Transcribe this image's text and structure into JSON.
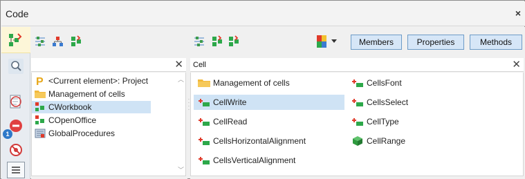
{
  "window": {
    "title": "Code",
    "close_label": "×"
  },
  "left": {
    "filter_value": "",
    "filter_clear": "✕",
    "items": [
      {
        "label": "<Current element>: Project",
        "icon": "project-p-icon"
      },
      {
        "label": "Management of cells",
        "icon": "folder-icon"
      },
      {
        "label": "CWorkbook",
        "icon": "class-icon",
        "selected": true
      },
      {
        "label": "COpenOffice",
        "icon": "class-icon"
      },
      {
        "label": "GlobalProcedures",
        "icon": "global-procedures-icon"
      }
    ]
  },
  "right": {
    "filter_value": "Cell",
    "filter_clear": "✕",
    "buttons": {
      "members": "Members",
      "properties": "Properties",
      "methods": "Methods"
    },
    "col1": [
      {
        "label": "Management of cells",
        "icon": "folder-icon"
      },
      {
        "label": "CellWrite",
        "icon": "method-icon",
        "selected": true
      },
      {
        "label": "CellRead",
        "icon": "method-icon"
      },
      {
        "label": "CellsHorizontalAlignment",
        "icon": "method-icon"
      },
      {
        "label": "CellsVerticalAlignment",
        "icon": "method-icon"
      }
    ],
    "col2": [
      {
        "label": "CellsFont",
        "icon": "method-icon"
      },
      {
        "label": "CellsSelect",
        "icon": "method-icon"
      },
      {
        "label": "CellType",
        "icon": "method-icon"
      },
      {
        "label": "CellRange",
        "icon": "cube-icon"
      }
    ]
  },
  "side": {
    "badge_count": "1"
  },
  "colors": {
    "accent": "#cfe3f5",
    "segment_button_bg": "#d6e6f7",
    "segment_button_border": "#6d9bc7",
    "highlight_strip": "#fdf6d8"
  }
}
